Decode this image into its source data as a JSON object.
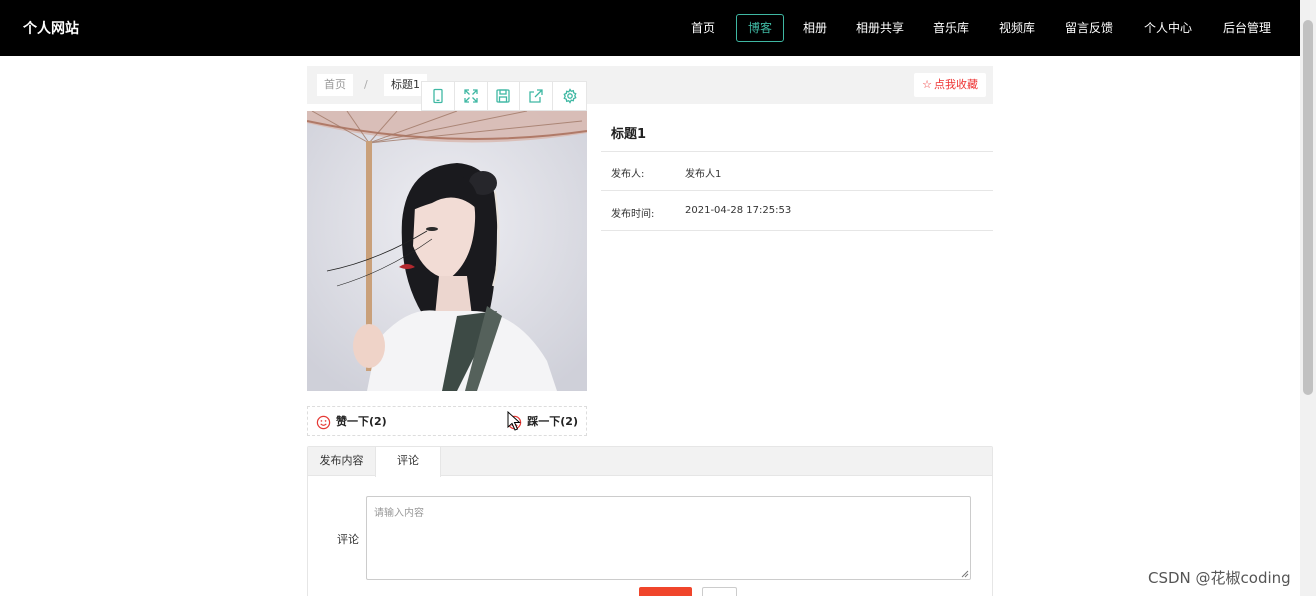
{
  "header": {
    "brand": "个人网站",
    "nav": [
      {
        "label": "首页",
        "active": false
      },
      {
        "label": "博客",
        "active": true
      },
      {
        "label": "相册",
        "active": false
      },
      {
        "label": "相册共享",
        "active": false
      },
      {
        "label": "音乐库",
        "active": false
      },
      {
        "label": "视频库",
        "active": false
      },
      {
        "label": "留言反馈",
        "active": false
      },
      {
        "label": "个人中心",
        "active": false
      },
      {
        "label": "后台管理",
        "active": false
      }
    ],
    "active_color": "#3fb8a3"
  },
  "breadcrumb": {
    "home": "首页",
    "separator": "/",
    "current": "标题1"
  },
  "favorite_button": "点我收藏",
  "toolbar_icons": [
    "mobile-icon",
    "expand-icon",
    "save-icon",
    "share-icon",
    "settings-icon"
  ],
  "vote": {
    "like_label": "赞一下(2)",
    "dislike_label": "踩一下(2)"
  },
  "detail": {
    "title": "标题1",
    "publisher_label": "发布人:",
    "publisher_value": "发布人1",
    "time_label": "发布时间:",
    "time_value": "2021-04-28 17:25:53"
  },
  "tabs": [
    {
      "label": "发布内容",
      "active": false
    },
    {
      "label": "评论",
      "active": true
    }
  ],
  "comment_form": {
    "label": "评论",
    "placeholder": "请输入内容"
  },
  "watermark": "CSDN @花椒coding",
  "colors": {
    "topbar": "#000000",
    "accent": "#3fb8a3",
    "favorite": "#e33333",
    "submit": "#f0452b"
  }
}
